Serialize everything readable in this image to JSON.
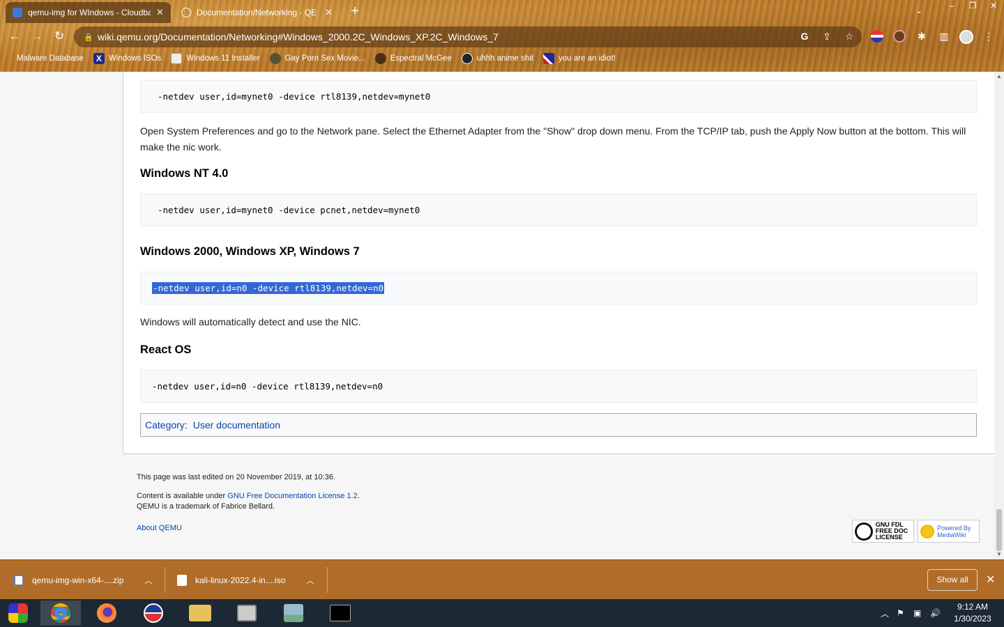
{
  "tabs": [
    {
      "title": "qemu-img for WIndows - Cloudba",
      "active": true
    },
    {
      "title": "Documentation/Networking - QE",
      "active": false
    }
  ],
  "window_controls": [
    "–",
    "❐",
    "✕"
  ],
  "address_bar": {
    "url": "wiki.qemu.org/Documentation/Networking#Windows_2000.2C_Windows_XP.2C_Windows_7"
  },
  "bookmarks": [
    {
      "label": "Malware Database",
      "icon": "generic-bookmark-icon"
    },
    {
      "label": "Windows ISOs",
      "icon": "x-logo-icon"
    },
    {
      "label": "Windows 11 Installer",
      "icon": "image-icon"
    },
    {
      "label": "Gay Porn Sex Movie...",
      "icon": "avatar-icon"
    },
    {
      "label": "Espectral McGee",
      "icon": "avatar-icon"
    },
    {
      "label": "uhhh anime shit",
      "icon": "avatar-icon"
    },
    {
      "label": "you are an idiot!",
      "icon": "flag-icon"
    }
  ],
  "page": {
    "code1": "-netdev user,id=mynet0 -device rtl8139,netdev=mynet0",
    "para1": "Open System Preferences and go to the Network pane. Select the Ethernet Adapter from the \"Show\" drop down menu. From the TCP/IP tab, push the Apply Now button at the bottom. This will make the nic work.",
    "heading_nt": "Windows NT 4.0",
    "code2": "-netdev user,id=mynet0 -device pcnet,netdev=mynet0",
    "heading_win": "Windows 2000, Windows XP, Windows 7",
    "code3": "-netdev user,id=n0 -device rtl8139,netdev=n0",
    "para2": "Windows will automatically detect and use the NIC.",
    "heading_react": "React OS",
    "code4": "-netdev user,id=n0 -device rtl8139,netdev=n0",
    "category_label": "Category",
    "category_sep": ":",
    "category_value": "User documentation"
  },
  "footer": {
    "last_edited": "This page was last edited on 20 November 2019, at 10:36.",
    "content_prefix": "Content is available under ",
    "license_link": "GNU Free Documentation License 1.2",
    "content_suffix": ".",
    "trademark": "QEMU is a trademark of Fabrice Bellard.",
    "about_link": "About QEMU",
    "badge_gfdl": "GNU FDL FREE DOC LICENSE",
    "badge_mediawiki": "Powered By MediaWiki"
  },
  "downloads": {
    "items": [
      {
        "name": "qemu-img-win-x64-....zip"
      },
      {
        "name": "kali-linux-2022.4-in....iso"
      }
    ],
    "show_all": "Show all",
    "close": "✕"
  },
  "taskbar": {
    "time": "9:12 AM",
    "date": "1/30/2023"
  },
  "colors": {
    "link": "#0645ad",
    "selection": "#3367d6",
    "taskbar": "#1c2833",
    "download_bar": "#b06d2a"
  }
}
